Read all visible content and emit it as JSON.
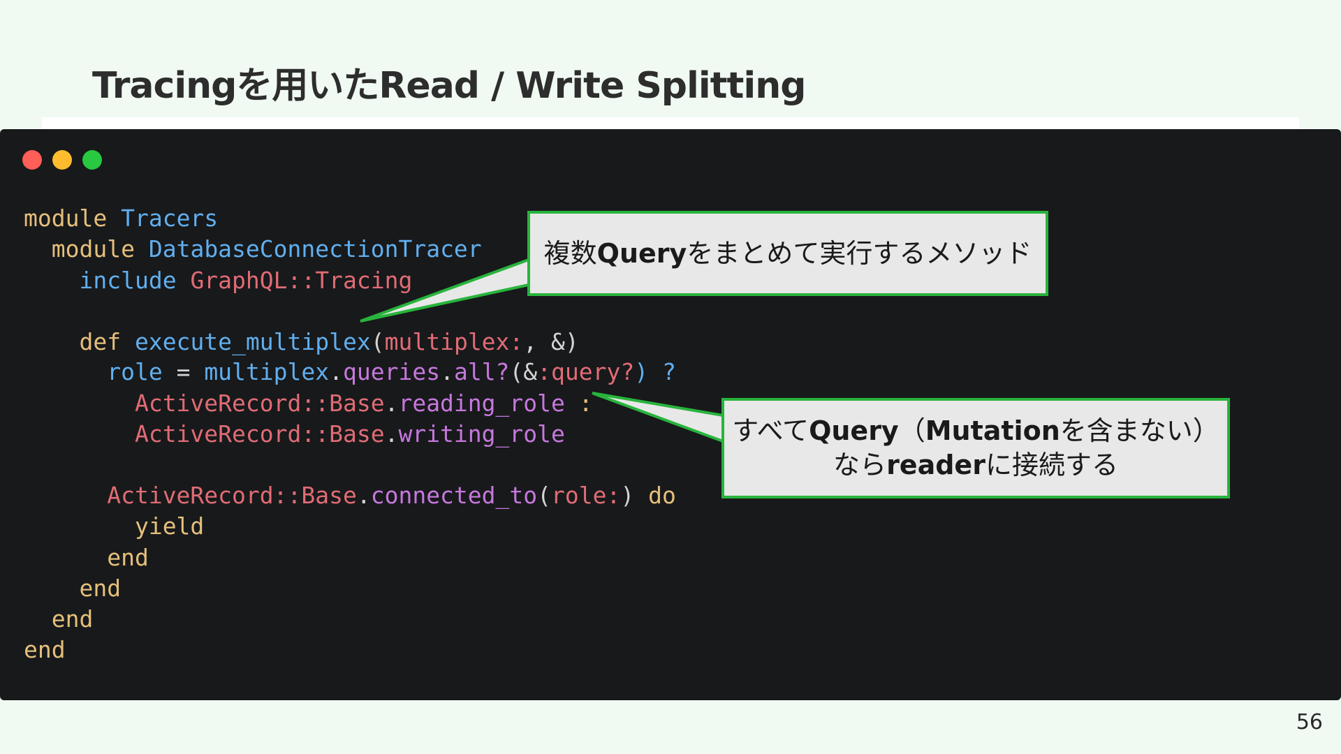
{
  "slide": {
    "title": "Tracingを用いたRead / Write Splitting",
    "page_number": "56"
  },
  "window_controls": {
    "close_color": "#ff5f57",
    "minimize_color": "#febc2e",
    "maximize_color": "#28c840"
  },
  "code": {
    "line1": {
      "kw": "module",
      "name": "Tracers"
    },
    "line2": {
      "kw": "module",
      "name": "DatabaseConnectionTracer"
    },
    "line3": {
      "kw": "include",
      "name": "GraphQL::Tracing"
    },
    "line5": {
      "kw": "def",
      "name": "execute_multiplex",
      "open": "(",
      "arg": "multiplex:",
      "rest": ", &)"
    },
    "line6": {
      "var": "role",
      "eq": " = ",
      "recv": "multiplex",
      "dot1": ".",
      "m1": "queries",
      "dot2": ".",
      "m2": "all?",
      "paren": "(&",
      "sym": ":query?",
      "close": ") ?"
    },
    "line7": {
      "cls": "ActiveRecord::Base",
      "dot": ".",
      "meth": "reading_role",
      "tail": " :"
    },
    "line8": {
      "cls": "ActiveRecord::Base",
      "dot": ".",
      "meth": "writing_role"
    },
    "line10": {
      "cls": "ActiveRecord::Base",
      "dot": ".",
      "meth": "connected_to",
      "open": "(",
      "arg": "role:",
      "close": ") ",
      "kw": "do"
    },
    "line11": {
      "kw": "yield"
    },
    "line12": {
      "kw": "end"
    },
    "line13": {
      "kw": "end"
    },
    "line14": {
      "kw": "end"
    },
    "line15": {
      "kw": "end"
    }
  },
  "callouts": {
    "c1": {
      "pre": "複数",
      "bold": "Query",
      "post": "をまとめて実行するメソッド"
    },
    "c2": {
      "l1_pre": "すべて",
      "l1_bold1": "Query",
      "l1_mid": "（",
      "l1_bold2": "Mutation",
      "l1_post": "を含まない）",
      "l2_pre": "なら",
      "l2_bold": "reader",
      "l2_post": "に接続する"
    },
    "border_color": "#28b43c",
    "fill_color": "#e8e8e8"
  }
}
